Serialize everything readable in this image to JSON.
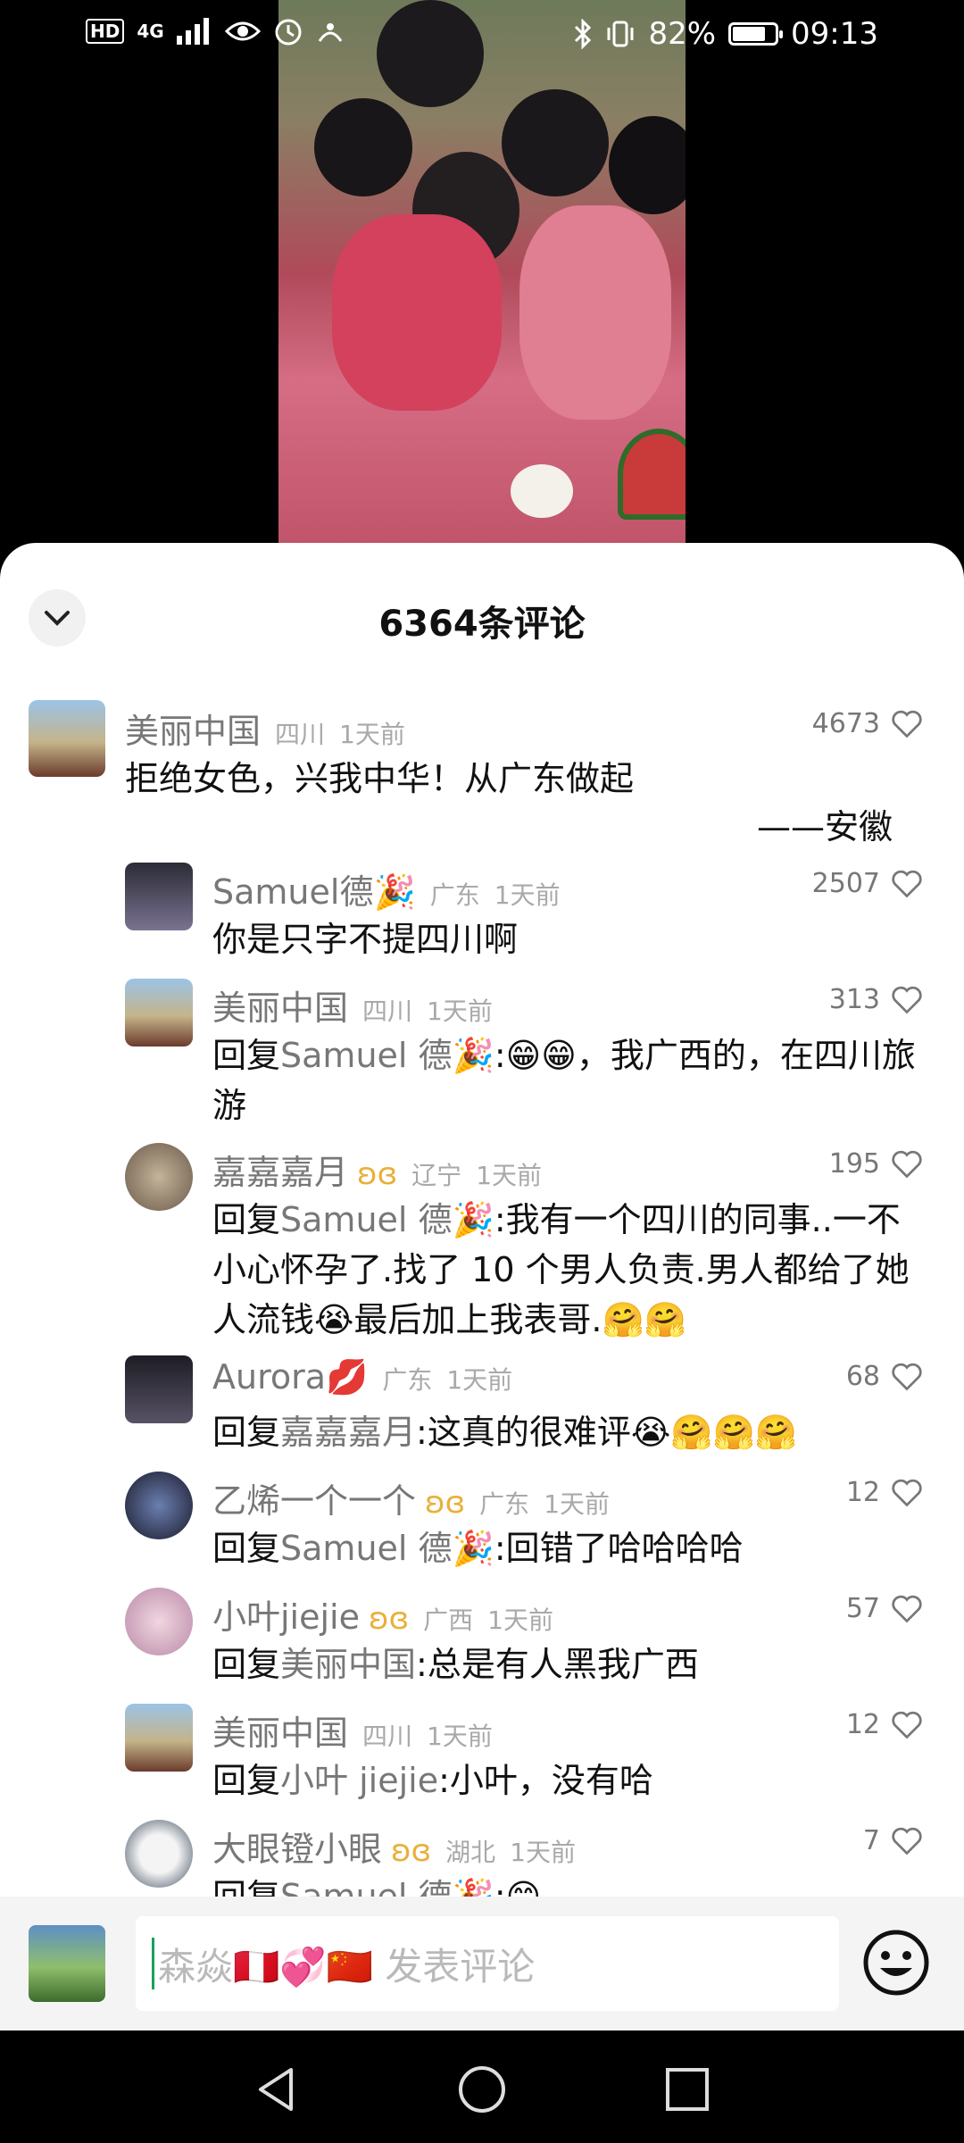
{
  "status_bar": {
    "network": "4G",
    "battery": "82%",
    "battery_level": 0.82,
    "time": "09:13"
  },
  "sheet": {
    "title": "6364条评论"
  },
  "comments": [
    {
      "user": "美丽中国",
      "region": "四川",
      "time": "1天前",
      "likes": "4673",
      "text": "拒绝女色，兴我中华！从广东做起",
      "signature": "——安徽"
    },
    {
      "user": "Samuel德🎉",
      "region": "广东",
      "time": "1天前",
      "likes": "2507",
      "text": "你是只字不提四川啊"
    },
    {
      "user": "美丽中国",
      "region": "四川",
      "time": "1天前",
      "likes": "313",
      "reply_prefix": "回复",
      "reply_to": "Samuel 德🎉",
      "text": ":😁😁，我广西的，在四川旅游"
    },
    {
      "user": "嘉嘉嘉月",
      "region": "辽宁",
      "time": "1天前",
      "likes": "195",
      "reply_prefix": "回复",
      "reply_to": "Samuel 德🎉",
      "text": ":我有一个四川的同事..一不小心怀孕了.找了 10 个男人负责.男人都给了她人流钱😭最后加上我表哥.🤗🤗"
    },
    {
      "user": "Aurora💋",
      "region": "广东",
      "time": "1天前",
      "likes": "68",
      "reply_prefix": "回复",
      "reply_to": "嘉嘉嘉月",
      "text": ":这真的很难评😭🤗🤗🤗"
    },
    {
      "user": "乙烯一个一个",
      "region": "广东",
      "time": "1天前",
      "likes": "12",
      "reply_prefix": "回复",
      "reply_to": "Samuel 德🎉",
      "text": ":回错了哈哈哈哈"
    },
    {
      "user": "小叶jiejie",
      "region": "广西",
      "time": "1天前",
      "likes": "57",
      "reply_prefix": "回复",
      "reply_to": "美丽中国",
      "text": ":总是有人黑我广西"
    },
    {
      "user": "美丽中国",
      "region": "四川",
      "time": "1天前",
      "likes": "12",
      "reply_prefix": "回复",
      "reply_to": "小叶 jiejie",
      "text": ":小叶，没有哈"
    },
    {
      "user": "大眼镫小眼",
      "region": "湖北",
      "time": "1天前",
      "likes": "7",
      "reply_prefix": "回复",
      "reply_to": "Samuel 德🎉",
      "text": ":😊"
    }
  ],
  "input": {
    "placeholder": "森焱🇵🇪💞🇨🇳 发表评论"
  },
  "colors": {
    "accent_cursor": "#1aa05c",
    "badge": "#e8b03a",
    "mention": "#777777"
  }
}
